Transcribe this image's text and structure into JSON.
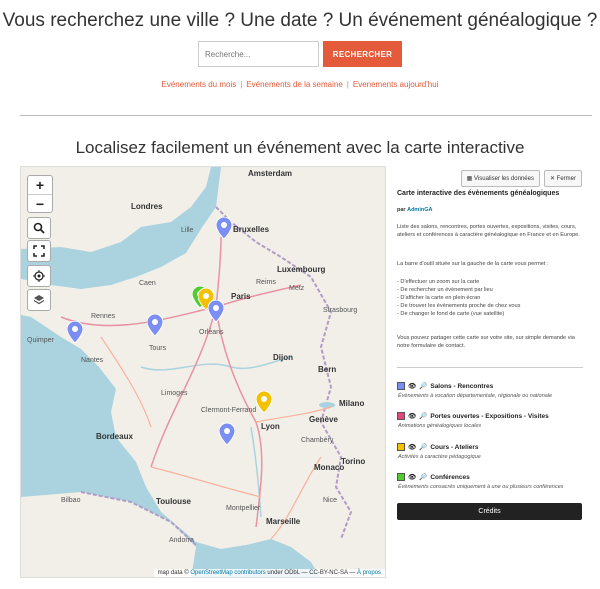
{
  "header": {
    "title": "Vous recherchez une ville ? Une date ? Un événement généalogique ?",
    "search_placeholder": "Recherche...",
    "search_button": "RECHERCHER",
    "links": [
      "Evénements du mois",
      "Evénements de la semaine",
      "Evenements aujourd'hui"
    ]
  },
  "section": {
    "title": "Localisez facilement un événement avec la carte interactive"
  },
  "map": {
    "labels": {
      "amsterdam": "Amsterdam",
      "london": "Londres",
      "bruxelles": "Bruxelles",
      "paris": "Paris",
      "luxembourg": "Luxembourg",
      "strasbourg": "Strasbourg",
      "dijon": "Dijon",
      "nantes": "Nantes",
      "rennes": "Rennes",
      "lyon": "Lyon",
      "geneve": "Genève",
      "bordeaux": "Bordeaux",
      "toulouse": "Toulouse",
      "marseille": "Marseille",
      "monaco": "Monaco",
      "milano": "Milano",
      "torino": "Torino",
      "bern": "Bern",
      "lille": "Lille",
      "quimper": "Quimper",
      "reims": "Reims",
      "metz": "Metz",
      "chambery": "Chambéry",
      "clermont": "Clermont-Ferrand",
      "tours": "Tours",
      "limoges": "Limoges",
      "montpellier": "Montpellier",
      "nice": "Nice",
      "andorra": "Andorra",
      "bilbao": "Bilbao",
      "orleans": "Orléans",
      "caen": "Caen"
    },
    "attribution_prefix": "map data ©",
    "attribution_link": "OpenStreetMap contributors",
    "attribution_suffix": "under ODbL — CC-BY-NC-SA —",
    "attribution_about": "À propos"
  },
  "panel": {
    "view_data_button": "Visualiser les données",
    "close_button": "Fermer",
    "title": "Carte interactive des évènements généalogiques",
    "author_prefix": "par",
    "author": "AdminGA",
    "intro": "Liste des salons, rencontres, portes ouvertes, expositions, visites, cours, ateliers et conférences à caractère généalogique en France et en Europe.",
    "toolbar_intro": "La barre d'outil située sur la gauche de la carte vous permet :",
    "toolbar_items": [
      "- D'effectuer un zoom sur la carte",
      "- De rechercher un évènement par lieu",
      "- D'afficher la carte en plein écran",
      "- De trouver les évènements proche de chez vous",
      "- De changer le fond de carte (vue satellite)"
    ],
    "share_text": "Vous pouvez partager cette carte sur votre site, sur simple demande via notre formulaire de contact.",
    "legend": [
      {
        "label": "Salons - Rencontres",
        "sub": "Évènements à vocation départementale, régionale ou nationale",
        "color": "#7b8ef2"
      },
      {
        "label": "Portes ouvertes - Expositions - Visites",
        "sub": "Animations généalogiques locales",
        "color": "#e2467a"
      },
      {
        "label": "Cours - Ateliers",
        "sub": "Activités à caractère pédagogique",
        "color": "#f2c200"
      },
      {
        "label": "Conférences",
        "sub": "Évènements consacrés uniquement à une ou plusieurs conférences",
        "color": "#52cc2f"
      }
    ],
    "credits_button": "Crédits"
  },
  "colors": {
    "accent": "#e35b3b",
    "pin_blue": "#7b8ef2",
    "pin_yellow": "#f2c200",
    "pin_green": "#52cc2f"
  }
}
